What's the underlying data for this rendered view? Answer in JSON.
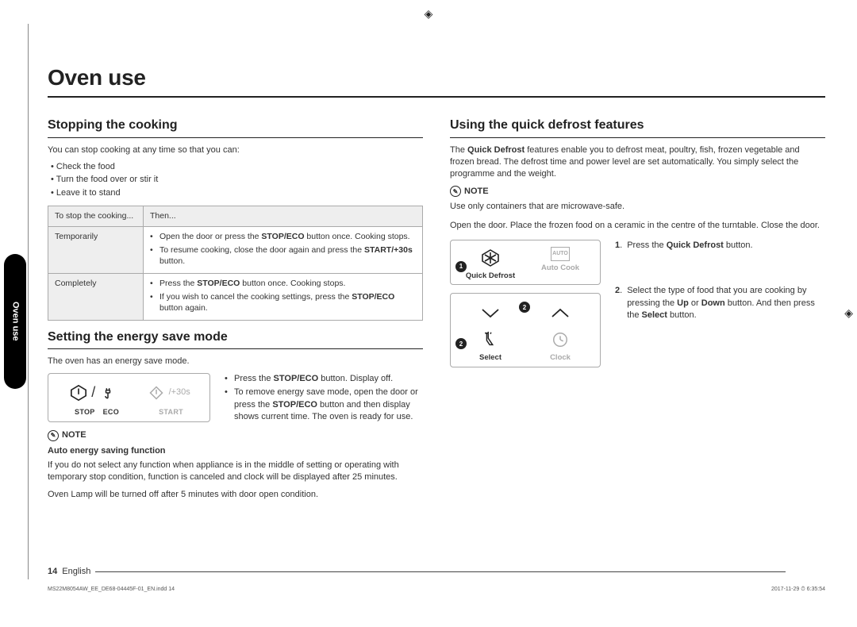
{
  "crop": "◈",
  "side_tab": "Oven use",
  "page_title": "Oven use",
  "left": {
    "sec1": {
      "title": "Stopping the cooking",
      "intro": "You can stop cooking at any time so that you can:",
      "bullets": [
        "Check the food",
        "Turn the food over or stir it",
        "Leave it to stand"
      ],
      "table": {
        "h1": "To stop the cooking...",
        "h2": "Then...",
        "r1_label": "Temporarily",
        "r1_b1a": "Open the door or press the ",
        "r1_b1b": "STOP/ECO",
        "r1_b1c": " button once. Cooking stops.",
        "r1_b2a": "To resume cooking, close the door again and press the ",
        "r1_b2b": "START/+30s",
        "r1_b2c": " button.",
        "r2_label": "Completely",
        "r2_b1a": "Press the ",
        "r2_b1b": "STOP/ECO",
        "r2_b1c": " button once. Cooking stops.",
        "r2_b2a": "If you wish to cancel the cooking settings, press the ",
        "r2_b2b": "STOP/ECO",
        "r2_b2c": " button again."
      }
    },
    "sec2": {
      "title": "Setting the energy save mode",
      "intro": "The oven has an energy save mode.",
      "panel": {
        "stop": "STOP",
        "eco": "ECO",
        "start": "START",
        "plus30": "/+30s"
      },
      "b1a": "Press the ",
      "b1b": "STOP/ECO",
      "b1c": " button. Display off.",
      "b2a": "To remove energy save mode, open the door or press the ",
      "b2b": "STOP/ECO",
      "b2c": " button and then display shows current time. The oven is ready for use.",
      "note_label": "NOTE",
      "note_sub": "Auto energy saving function",
      "note_p1": "If you do not select any function when appliance is in the middle of setting or operating with temporary stop condition, function is canceled and clock will be displayed after 25 minutes.",
      "note_p2": "Oven Lamp will be turned off after 5 minutes with door open condition."
    }
  },
  "right": {
    "title": "Using the quick defrost features",
    "intro_a": "The ",
    "intro_b": "Quick Defrost",
    "intro_c": " features enable you to defrost meat, poultry, fish, frozen vegetable and frozen bread. The defrost time and power level are set automatically. You simply select the programme and the weight.",
    "note_label": "NOTE",
    "note_body": "Use only containers that are microwave-safe.",
    "prep": "Open the door. Place the frozen food on a ceramic in the centre of the turntable. Close the door.",
    "panel": {
      "qd": "Quick Defrost",
      "ac": "Auto Cook",
      "select": "Select",
      "clock": "Clock",
      "auto": "AUTO"
    },
    "steps": {
      "n1": "1",
      "s1a": "Press the ",
      "s1b": "Quick Defrost",
      "s1c": " button.",
      "n2": "2",
      "s2a": "Select the type of food that you are cooking by pressing the ",
      "s2b": "Up",
      "s2c": " or ",
      "s2d": "Down",
      "s2e": " button. And then press the ",
      "s2f": "Select",
      "s2g": " button."
    }
  },
  "footer": {
    "page": "14",
    "lang": "English"
  },
  "imprint": {
    "left": "MS22M8054AW_EE_DE68-04445F-01_EN.indd   14",
    "right": "2017-11-29   ⏱ 6:35:54"
  }
}
